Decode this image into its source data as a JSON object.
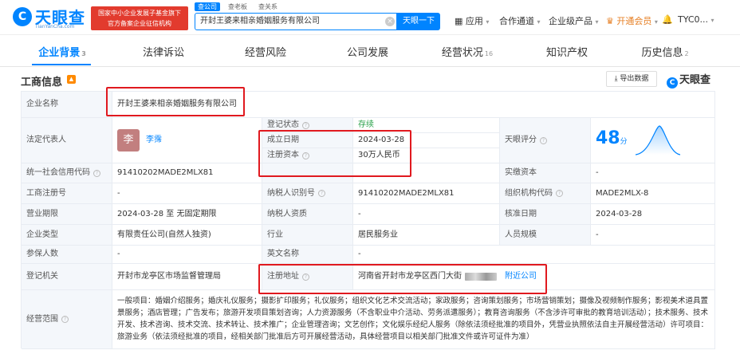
{
  "header": {
    "logo_mark": "C",
    "logo_text": "天眼查",
    "logo_sub": "TianYanCha.com",
    "badge_line1": "国家中小企业发展子基金旗下",
    "badge_line2": "官方备案企业征信机构",
    "search_tabs": [
      "查公司",
      "查老板",
      "查关系"
    ],
    "search_value": "开封王婆来相亲婚姻服务有限公司",
    "search_button": "天眼一下",
    "nav": {
      "app": "应用",
      "channel": "合作通道",
      "enterprise": "企业级产品",
      "vip": "开通会员",
      "user": "TYC0..."
    }
  },
  "tabs": [
    {
      "label": "企业背景",
      "count": "3"
    },
    {
      "label": "法律诉讼",
      "count": ""
    },
    {
      "label": "经营风险",
      "count": ""
    },
    {
      "label": "公司发展",
      "count": ""
    },
    {
      "label": "经营状况",
      "count": "16"
    },
    {
      "label": "知识产权",
      "count": ""
    },
    {
      "label": "历史信息",
      "count": "2"
    }
  ],
  "section": {
    "title": "工商信息",
    "export_label": "导出数据",
    "brand": "天眼查"
  },
  "info": {
    "company_name_label": "企业名称",
    "company_name": "开封王婆来相亲婚姻服务有限公司",
    "legal_rep_label": "法定代表人",
    "legal_rep_avatar": "李",
    "legal_rep_name": "李霈",
    "reg_status_label": "登记状态",
    "reg_status": "存续",
    "established_label": "成立日期",
    "established": "2024-03-28",
    "reg_capital_label": "注册资本",
    "reg_capital": "30万人民币",
    "score_label": "天眼评分",
    "score_value": "48",
    "score_unit": "分",
    "credit_code_label": "统一社会信用代码",
    "credit_code": "91410202MADE2MLX81",
    "paid_capital_label": "实缴资本",
    "paid_capital": "-",
    "biz_reg_no_label": "工商注册号",
    "biz_reg_no": "-",
    "taxpayer_id_label": "纳税人识别号",
    "taxpayer_id": "91410202MADE2MLX81",
    "org_code_label": "组织机构代码",
    "org_code": "MADE2MLX-8",
    "term_label": "营业期限",
    "term": "2024-03-28 至 无固定期限",
    "taxpayer_qual_label": "纳税人资质",
    "taxpayer_qual": "-",
    "approval_date_label": "核准日期",
    "approval_date": "2024-03-28",
    "company_type_label": "企业类型",
    "company_type": "有限责任公司(自然人独资)",
    "industry_label": "行业",
    "industry": "居民服务业",
    "staff_size_label": "人员规模",
    "staff_size": "-",
    "insured_label": "参保人数",
    "insured": "-",
    "english_name_label": "英文名称",
    "english_name": "-",
    "reg_authority_label": "登记机关",
    "reg_authority": "开封市龙亭区市场监督管理局",
    "reg_address_label": "注册地址",
    "reg_address": "河南省开封市龙亭区西门大街",
    "nearby_link": "附近公司",
    "scope_label": "经营范围",
    "scope": "一般项目：婚姻介绍服务；婚庆礼仪服务；摄影扩印服务；礼仪服务；组织文化艺术交流活动；家政服务；咨询策划服务；市场营销策划；摄像及视频制作服务；影视美术道具置景服务；酒店管理；广告发布；旅游开发项目策划咨询；人力资源服务（不含职业中介活动、劳务派遣服务）；教育咨询服务（不含涉许可审批的教育培训活动）；技术服务、技术开发、技术咨询、技术交流、技术转让、技术推广；企业管理咨询；文艺创作；文化娱乐经纪人服务（除依法须经批准的项目外，凭营业执照依法自主开展经营活动）许可项目：旅游业务（依法须经批准的项目，经相关部门批准后方可开展经营活动，具体经营项目以相关部门批准文件或许可证件为准）"
  },
  "colors": {
    "accent": "#0084ff",
    "highlight_box": "#e0191f",
    "status_green": "#2ba14b"
  }
}
